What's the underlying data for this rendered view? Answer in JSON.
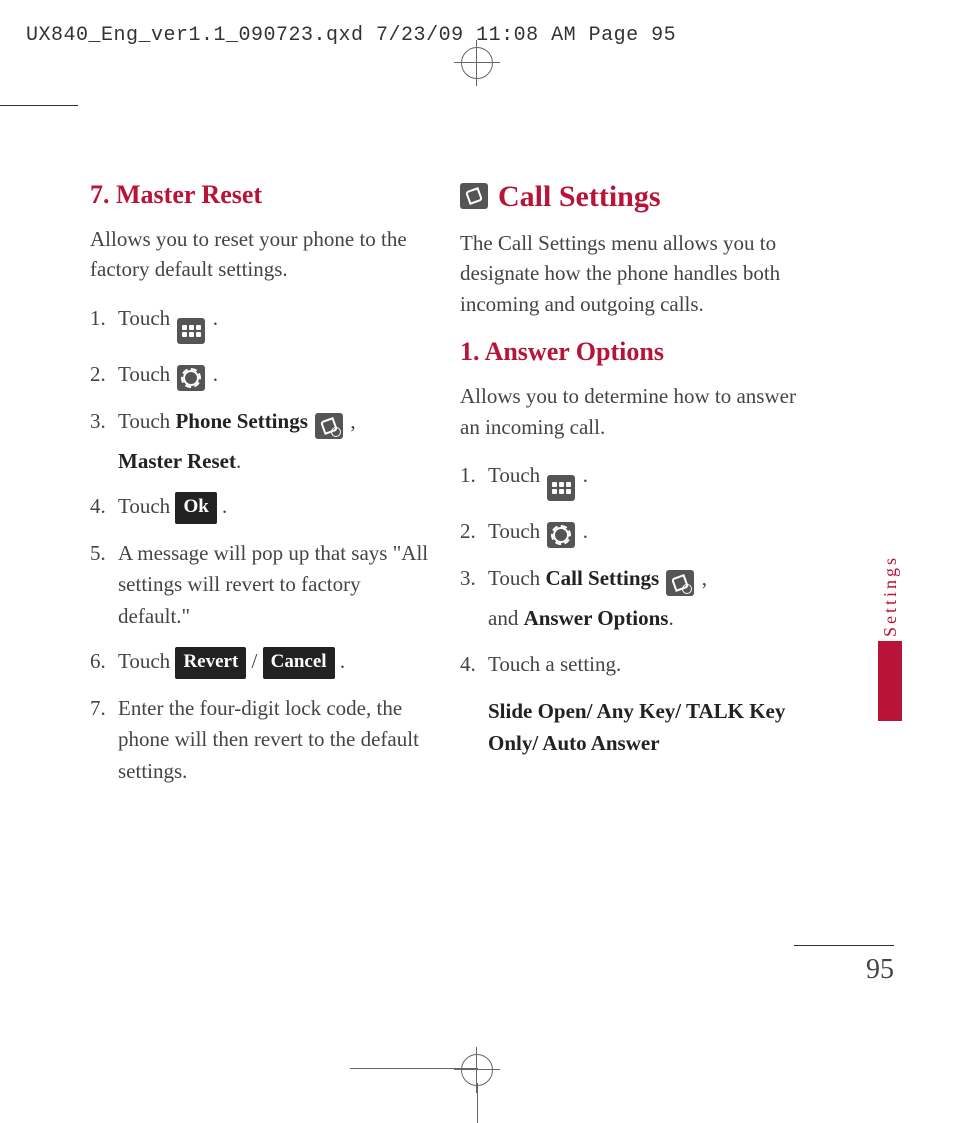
{
  "print_header": "UX840_Eng_ver1.1_090723.qxd  7/23/09  11:08 AM  Page 95",
  "side_tab": "Settings",
  "page_number": "95",
  "left": {
    "heading": "7. Master Reset",
    "intro": "Allows you to reset your phone to the factory default settings.",
    "steps": {
      "s1_a": "Touch ",
      "s1_b": ".",
      "s2_a": "Touch ",
      "s2_b": ".",
      "s3_a": "Touch ",
      "s3_bold1": "Phone Settings",
      "s3_b": " ",
      "s3_c": ",",
      "s3_bold2": "Master Reset",
      "s3_d": ".",
      "s4_a": "Touch ",
      "s4_btn": "Ok",
      "s4_b": " .",
      "s5": "A message will pop up that says \"All settings will revert to factory default.\"",
      "s6_a": "Touch ",
      "s6_btn1": "Revert",
      "s6_mid": " / ",
      "s6_btn2": "Cancel",
      "s6_b": " .",
      "s7": "Enter the four-digit lock code, the phone will then revert to the default settings."
    }
  },
  "right": {
    "heading": "Call Settings",
    "intro": "The Call Settings menu allows you to designate how the phone handles both incoming and outgoing calls.",
    "sub_heading": "1. Answer Options",
    "sub_intro": "Allows you to determine how to answer an incoming call.",
    "steps": {
      "s1_a": "Touch ",
      "s1_b": ".",
      "s2_a": "Touch ",
      "s2_b": ".",
      "s3_a": "Touch ",
      "s3_bold1": "Call Settings",
      "s3_b": " ",
      "s3_c": ",",
      "s3_mid": "and ",
      "s3_bold2": "Answer Options",
      "s3_d": ".",
      "s4": "Touch a setting.",
      "s4_options": "Slide Open/ Any Key/ TALK Key Only/ Auto Answer"
    }
  }
}
